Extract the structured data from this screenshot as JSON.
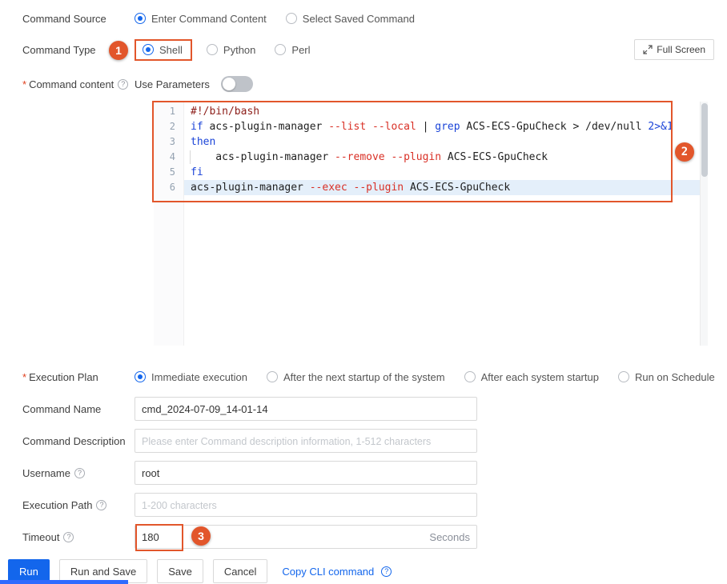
{
  "annotation": {
    "color": "#E2562B",
    "badge1": "1",
    "badge2": "2",
    "badge3": "3"
  },
  "command_source": {
    "label": "Command Source",
    "options": [
      {
        "label": "Enter Command Content",
        "selected": true
      },
      {
        "label": "Select Saved Command",
        "selected": false
      }
    ]
  },
  "command_type": {
    "label": "Command Type",
    "options": [
      {
        "label": "Shell",
        "selected": true
      },
      {
        "label": "Python",
        "selected": false
      },
      {
        "label": "Perl",
        "selected": false
      }
    ],
    "full_screen_label": "Full Screen"
  },
  "command_content": {
    "required_mark": "*",
    "label": "Command content",
    "use_parameters_label": "Use Parameters",
    "use_parameters_on": false
  },
  "editor": {
    "lines": [
      {
        "num": "1",
        "tokens": [
          {
            "text": "#!/bin/bash",
            "type": "shebang"
          }
        ]
      },
      {
        "num": "2",
        "tokens": [
          {
            "text": "if ",
            "type": "kw"
          },
          {
            "text": "acs-plugin-manager ",
            "type": "plain"
          },
          {
            "text": "--list --local",
            "type": "opt"
          },
          {
            "text": " | ",
            "type": "plain"
          },
          {
            "text": "grep",
            "type": "kw"
          },
          {
            "text": " ACS-ECS-GpuCheck > /dev/null ",
            "type": "plain"
          },
          {
            "text": "2>&1",
            "type": "kw"
          }
        ]
      },
      {
        "num": "3",
        "tokens": [
          {
            "text": "then",
            "type": "kw"
          }
        ]
      },
      {
        "num": "4",
        "tokens": [
          {
            "text": "    acs-plugin-manager ",
            "type": "plain"
          },
          {
            "text": "--remove --plugin",
            "type": "opt"
          },
          {
            "text": " ACS-ECS-GpuCheck",
            "type": "plain"
          }
        ]
      },
      {
        "num": "5",
        "tokens": [
          {
            "text": "fi",
            "type": "kw"
          }
        ]
      },
      {
        "num": "6",
        "tokens": [
          {
            "text": "acs-plugin-manager ",
            "type": "plain"
          },
          {
            "text": "--exec --plugin",
            "type": "opt"
          },
          {
            "text": " ACS-ECS-GpuCheck",
            "type": "plain"
          }
        ]
      }
    ]
  },
  "execution_plan": {
    "required_mark": "*",
    "label": "Execution Plan",
    "options": [
      {
        "label": "Immediate execution",
        "selected": true
      },
      {
        "label": "After the next startup of the system",
        "selected": false
      },
      {
        "label": "After each system startup",
        "selected": false
      },
      {
        "label": "Run on Schedule",
        "selected": false
      }
    ]
  },
  "fields": {
    "command_name": {
      "label": "Command Name",
      "value": "cmd_2024-07-09_14-01-14"
    },
    "command_description": {
      "label": "Command Description",
      "placeholder": "Please enter Command description information, 1-512 characters"
    },
    "username": {
      "label": "Username",
      "value": "root"
    },
    "execution_path": {
      "label": "Execution Path",
      "placeholder": "1-200 characters"
    },
    "timeout": {
      "label": "Timeout",
      "value": "180",
      "suffix": "Seconds"
    }
  },
  "footer": {
    "run_label": "Run",
    "run_and_save_label": "Run and Save",
    "save_label": "Save",
    "cancel_label": "Cancel",
    "copy_cli_label": "Copy CLI command"
  }
}
